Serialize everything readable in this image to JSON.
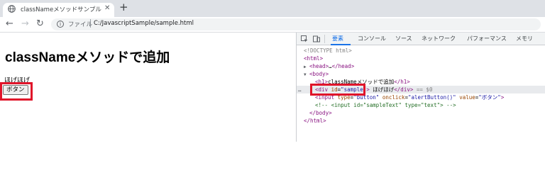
{
  "browser": {
    "tab": {
      "title": "classNameメソッドサンプル",
      "close": "✕"
    },
    "new_tab": "+",
    "nav": {
      "back": "←",
      "forward": "→",
      "reload": "↻"
    },
    "address": {
      "info": "i",
      "scheme": "ファイル",
      "url": "C:/JavascriptSample/sample.html"
    }
  },
  "page": {
    "heading": "classNameメソッドで追加",
    "text": "ほげほげ",
    "button": "ボタン"
  },
  "devtools": {
    "tabs": [
      "要素",
      "コンソール",
      "ソース",
      "ネットワーク",
      "パフォーマンス",
      "メモリ"
    ],
    "active_tab": "要素",
    "dom": {
      "doctype": "<!DOCTYPE html>",
      "html_open": "<html>",
      "head_open": "<head>",
      "head_ellipsis": "…",
      "head_close": "</head>",
      "body_open": "<body>",
      "h1_open": "<h1>",
      "h1_text": "classNameメソッドで追加",
      "h1_close": "</h1>",
      "div_open": "<div",
      "div_attr": "id",
      "div_attr_val": "\"sample\"",
      "div_gt": ">",
      "div_text": "ほげほげ",
      "div_close": "</div>",
      "div_marker": "== $0",
      "input_open": "<input",
      "input_type_attr": "type",
      "input_type_val": "\"button\"",
      "input_onclick_attr": "onclick",
      "input_onclick_val": "\"alertButton()\"",
      "input_value_attr": "value",
      "input_value_val": "\"ボタン\"",
      "input_gt": ">",
      "comment": "<!-- <input id=\"sampleText\" type=\"text\"> -->",
      "body_close": "</body>",
      "html_close": "</html>",
      "row_menu": "…"
    }
  },
  "colors": {
    "highlight": "#e0142a",
    "accent": "#1a73e8"
  }
}
